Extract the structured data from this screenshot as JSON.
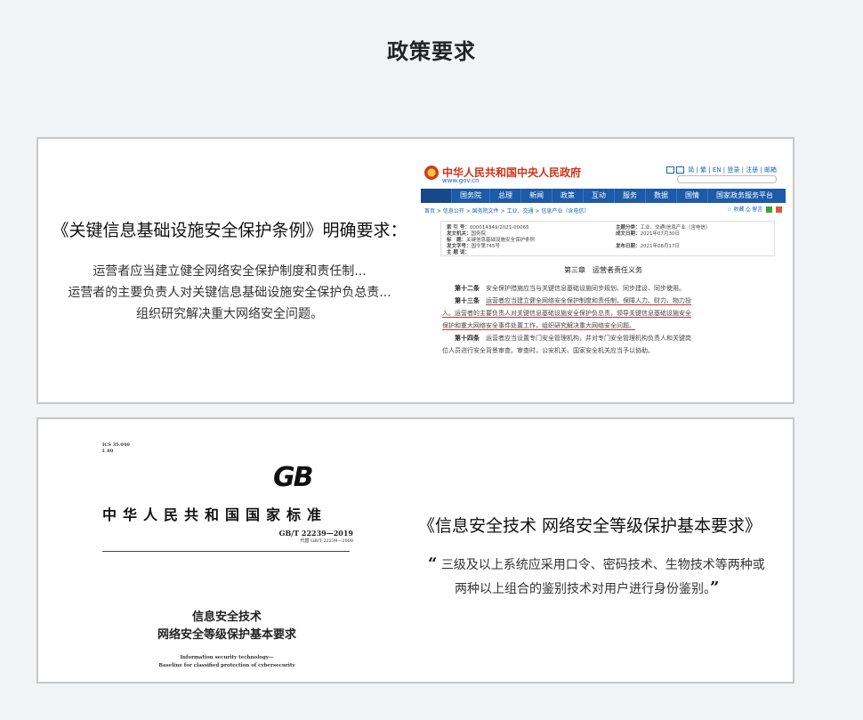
{
  "page": {
    "title": "政策要求"
  },
  "card1": {
    "heading": "《关键信息基础设施安全保护条例》明确要求：",
    "lines": [
      "运营者应当建立健全网络安全保护制度和责任制...",
      "运营者的主要负责人对关键信息基础设施安全保护负总责...",
      "组织研究解决重大网络安全问题。"
    ],
    "gov": {
      "site_title": "中华人民共和国中央人民政府",
      "domain": "www.gov.cn",
      "tools": "简 | 繁 | EN | 登录 | 注册 | 邮箱",
      "nav": [
        "国务院",
        "总理",
        "新闻",
        "政策",
        "互动",
        "服务",
        "数据",
        "国情",
        "国家政务服务平台"
      ],
      "breadcrumb": "首页 > 信息公开 > 国务院文件 > 工业、交通 > 信息产业（含电信）",
      "share": "☆ 收藏  ⎙ 留言",
      "meta_left": [
        [
          "索 引 号：",
          "000014349/2021-00065"
        ],
        [
          "发文机关：",
          "国务院"
        ],
        [
          "标　题：",
          "关键信息基础设施安全保护条例"
        ],
        [
          "发文字号：",
          "国令第745号"
        ],
        [
          "主 题 词：",
          ""
        ]
      ],
      "meta_right": [
        [
          "主题分类：",
          "工业、交通\\信息产业（含电信）"
        ],
        [
          "成文日期：",
          "2021年07月30日"
        ],
        [
          "",
          ""
        ],
        [
          "发布日期：",
          "2021年08月17日"
        ]
      ],
      "chapter": "第三章　运营者责任义务",
      "art12_num": "第十二条",
      "art12": "安全保护措施应当与关键信息基础设施同步规划、同步建设、同步使用。",
      "art13_num": "第十三条",
      "art13_a": "运营者应当建立健全网络安全保护制度和责任制，保障人力、财力、物力投",
      "art13_b": "入。运营者的主要负责人对关键信息基础设施安全保护负总责，领导关键信息基础设施安全",
      "art13_c": "保护和重大网络安全事件处置工作，组织研究解决重大网络安全问题。",
      "art14_num": "第十四条",
      "art14_a": "运营者应当设置专门安全管理机构，并对专门安全管理机构负责人和关键岗",
      "art14_b": "位人员进行安全背景审查。审查时，公安机关、国家安全机关应当予以协助。"
    }
  },
  "card2": {
    "heading": "《信息安全技术 网络安全等级保护基本要求》",
    "quote_open": "“",
    "quote_line1": "三级及以上系统应采用口令、密码技术、生物技术等两种或",
    "quote_line2": "两种以上组合的鉴别技术对用户进行身份鉴别。",
    "quote_close": "”",
    "gb": {
      "ics": "ICS 35.040",
      "ccs": "L 80",
      "logo": "GB",
      "standard_name": "中华人民共和国国家标准",
      "code": "GB/T 22239—2019",
      "replaces": "代替 GB/T 22239—2008",
      "title_line1": "信息安全技术",
      "title_line2": "网络安全等级保护基本要求",
      "en_line1": "Information security technology—",
      "en_line2": "Baseline for classified protection of cybersecurity"
    }
  }
}
